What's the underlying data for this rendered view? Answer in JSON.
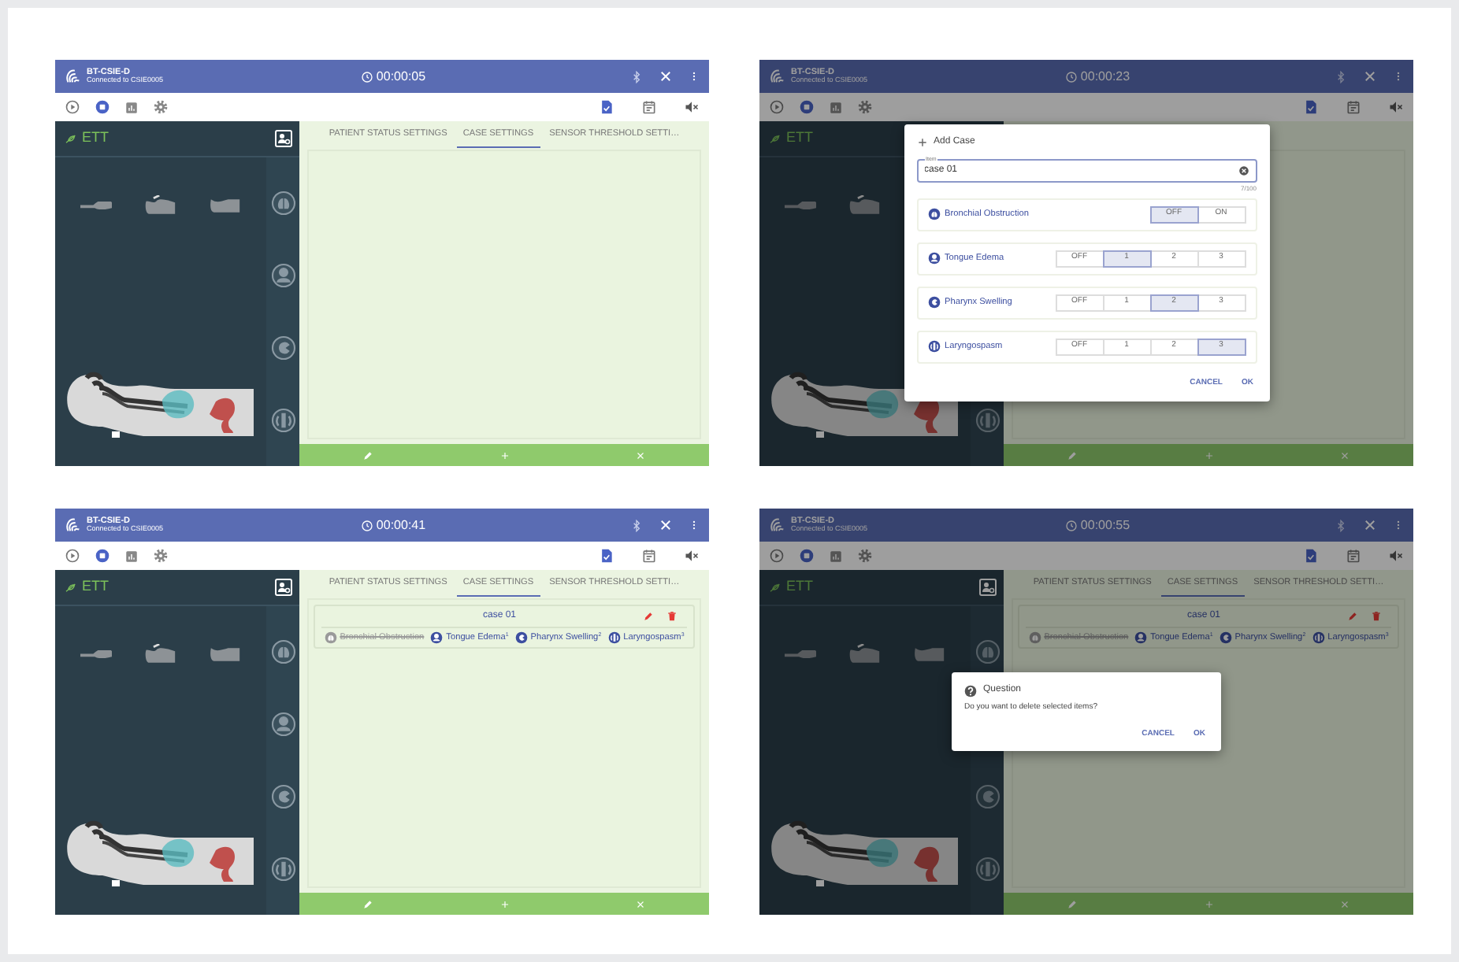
{
  "screens": [
    {
      "app_title": "BT-CSIE-D",
      "app_subtitle": "Connected to CSIE0005",
      "timer": "00:00:05",
      "panel_title": "ETT",
      "tabs": [
        {
          "label": "PATIENT STATUS SETTINGS",
          "selected": false
        },
        {
          "label": "CASE SETTINGS",
          "selected": true
        },
        {
          "label": "SENSOR THRESHOLD SETTI…",
          "selected": false
        }
      ]
    },
    {
      "app_title": "BT-CSIE-D",
      "app_subtitle": "Connected to CSIE0005",
      "timer": "00:00:23",
      "panel_title": "ETT",
      "dialog": {
        "kind": "add_case",
        "title": "Add Case",
        "field_label": "Item",
        "value": "case 01",
        "counter": "7/100",
        "rows": [
          {
            "name": "Bronchial Obstruction",
            "options": [
              {
                "label": "OFF",
                "selected": true
              },
              {
                "label": "ON",
                "selected": false
              }
            ]
          },
          {
            "name": "Tongue Edema",
            "options": [
              {
                "label": "OFF",
                "selected": false
              },
              {
                "label": "1",
                "selected": true
              },
              {
                "label": "2",
                "selected": false
              },
              {
                "label": "3",
                "selected": false
              }
            ]
          },
          {
            "name": "Pharynx Swelling",
            "options": [
              {
                "label": "OFF",
                "selected": false
              },
              {
                "label": "1",
                "selected": false
              },
              {
                "label": "2",
                "selected": true
              },
              {
                "label": "3",
                "selected": false
              }
            ]
          },
          {
            "name": "Laryngospasm",
            "options": [
              {
                "label": "OFF",
                "selected": false
              },
              {
                "label": "1",
                "selected": false
              },
              {
                "label": "2",
                "selected": false
              },
              {
                "label": "3",
                "selected": true
              }
            ]
          }
        ],
        "buttons": [
          "CANCEL",
          "OK"
        ]
      }
    },
    {
      "app_title": "BT-CSIE-D",
      "app_subtitle": "Connected to CSIE0005",
      "timer": "00:00:41",
      "panel_title": "ETT",
      "tabs": [
        {
          "label": "PATIENT STATUS SETTINGS",
          "selected": false
        },
        {
          "label": "CASE SETTINGS",
          "selected": true
        },
        {
          "label": "SENSOR THRESHOLD SETTI…",
          "selected": false
        }
      ],
      "cases": [
        {
          "name": "case 01",
          "conditions": [
            {
              "name": "Bronchial Obstruction",
              "active": false
            },
            {
              "name": "Tongue Edema",
              "severity": "1",
              "active": true
            },
            {
              "name": "Pharynx Swelling",
              "severity": "2",
              "active": true
            },
            {
              "name": "Laryngospasm",
              "severity": "3",
              "active": true
            }
          ]
        }
      ]
    },
    {
      "app_title": "BT-CSIE-D",
      "app_subtitle": "Connected to CSIE0005",
      "timer": "00:00:55",
      "panel_title": "ETT",
      "tabs": [
        {
          "label": "PATIENT STATUS SETTINGS",
          "selected": false
        },
        {
          "label": "CASE SETTINGS",
          "selected": true
        },
        {
          "label": "SENSOR THRESHOLD SETTI…",
          "selected": false
        }
      ],
      "cases": [
        {
          "name": "case 01",
          "conditions": [
            {
              "name": "Bronchial Obstruction",
              "active": false
            },
            {
              "name": "Tongue Edema",
              "severity": "1",
              "active": true
            },
            {
              "name": "Pharynx Swelling",
              "severity": "2",
              "active": true
            },
            {
              "name": "Laryngospasm",
              "severity": "3",
              "active": true
            }
          ]
        }
      ],
      "dialog": {
        "kind": "question",
        "title": "Question",
        "message": "Do you want to delete selected items?",
        "buttons": [
          "CANCEL",
          "OK"
        ]
      }
    }
  ]
}
